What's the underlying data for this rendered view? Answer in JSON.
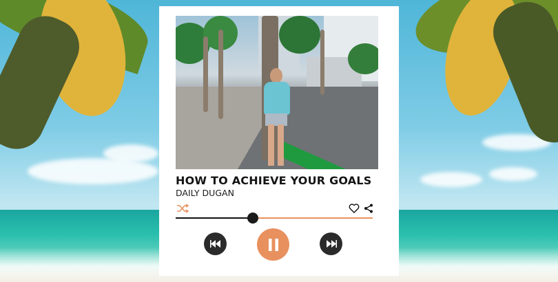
{
  "track": {
    "title": "HOW TO ACHIEVE YOUR GOALS",
    "artist": "DAILY DUGAN",
    "progress": 0.39
  },
  "icons": {
    "shuffle": "shuffle-icon",
    "like": "heart-icon",
    "share": "share-icon",
    "previous": "skip-back-icon",
    "pause": "pause-icon",
    "next": "skip-forward-icon"
  },
  "colors": {
    "accent": "#e8915f",
    "dark": "#2b2b2b",
    "card": "#ffffff"
  }
}
